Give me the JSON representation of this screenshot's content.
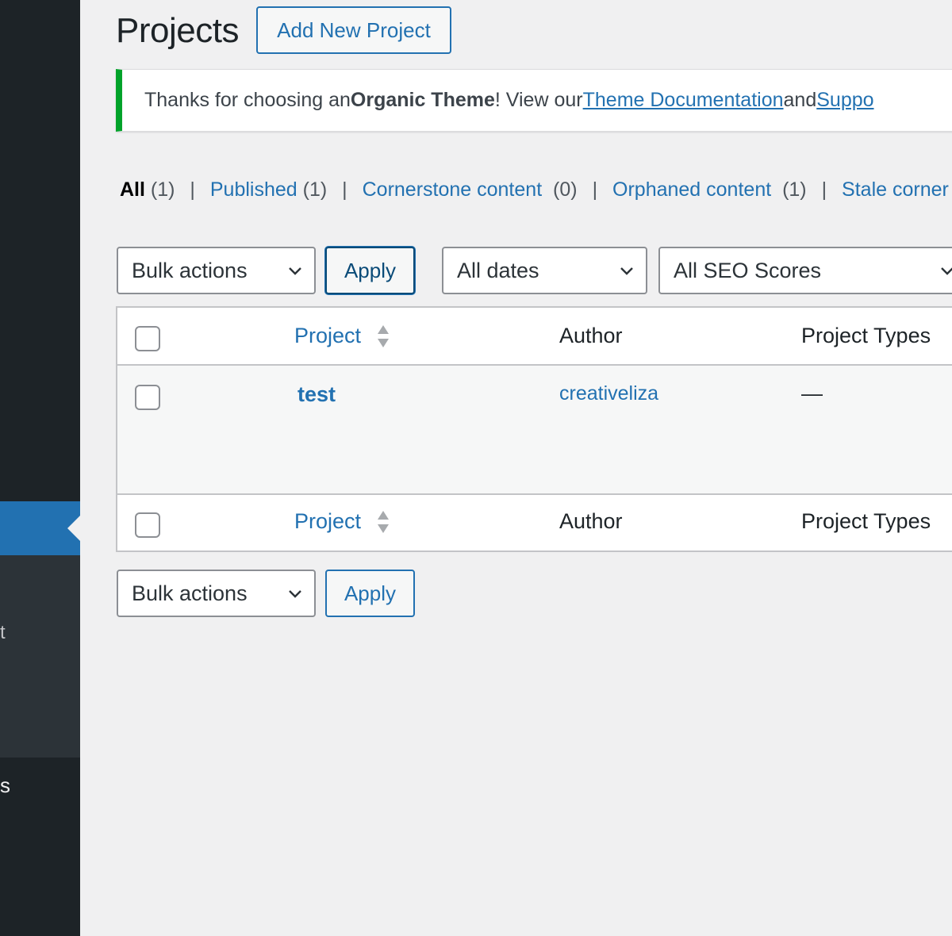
{
  "page": {
    "title": "Projects",
    "add_new_label": "Add New Project"
  },
  "sidebar": {
    "submenu_fragment": "t",
    "menu_fragment": "s"
  },
  "notice": {
    "text_start": "Thanks for choosing an ",
    "theme_name": "Organic Theme",
    "text_mid": "! View our ",
    "docs_link": "Theme Documentation",
    "text_and": " and ",
    "support_link": "Suppo"
  },
  "views": [
    {
      "label": "All",
      "count": "(1)",
      "current": true
    },
    {
      "label": "Published",
      "count": "(1)"
    },
    {
      "label": "Cornerstone content",
      "count": "(0)"
    },
    {
      "label": "Orphaned content",
      "count": "(1)"
    },
    {
      "label": "Stale corner",
      "count": ""
    }
  ],
  "top_filters": {
    "bulk_actions": "Bulk actions",
    "apply": "Apply",
    "dates": "All dates",
    "seo_scores": "All SEO Scores"
  },
  "table": {
    "columns": {
      "title": "Project",
      "author": "Author",
      "types": "Project Types"
    },
    "rows": [
      {
        "title": "test",
        "author": "creativeliza",
        "types": "—"
      }
    ]
  },
  "bottom_filters": {
    "bulk_actions": "Bulk actions",
    "apply": "Apply"
  },
  "colors": {
    "accent": "#2271b1",
    "sidebar": "#1d2327",
    "notice_border": "#00a32a"
  }
}
